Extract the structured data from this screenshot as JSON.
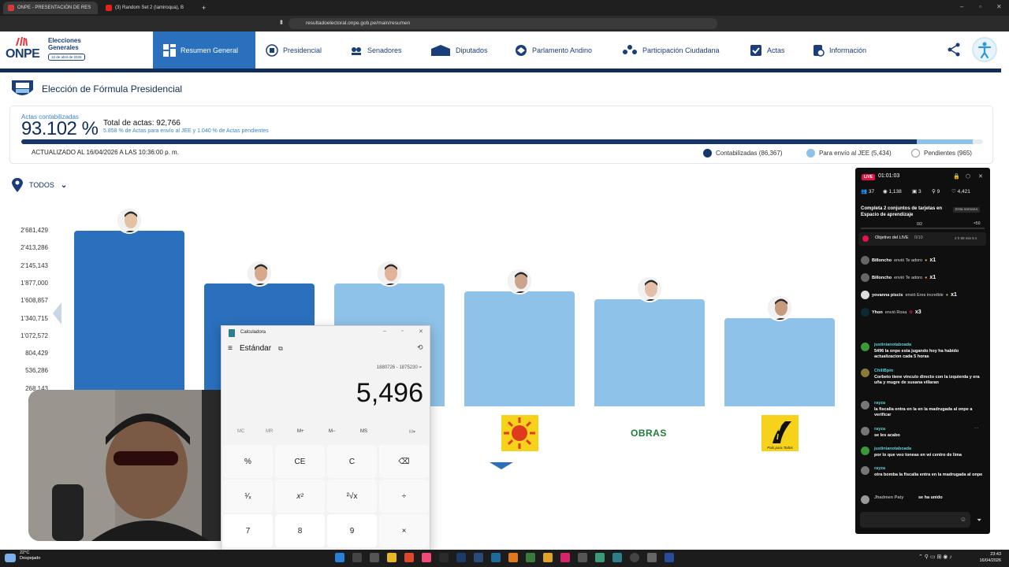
{
  "browser": {
    "tabs": [
      {
        "title": "ONPE - PRESENTACIÓN DE RES"
      },
      {
        "title": "(3) Random Set 2 (Iamiroqua), B"
      }
    ],
    "new_tab": "+",
    "url": "resultadoelectoral.onpe.gob.pe/main/resumen"
  },
  "header": {
    "logo": "ONPE",
    "elecciones": "Elecciones Generales",
    "date_badge": "12 de abril de 2026",
    "nav": [
      {
        "label": "Resumen General",
        "icon": "grid-icon"
      },
      {
        "label": "Presidencial",
        "icon": "peru-seal-icon"
      },
      {
        "label": "Senadores",
        "icon": "senate-icon"
      },
      {
        "label": "Diputados",
        "icon": "congress-icon"
      },
      {
        "label": "Parlamento Andino",
        "icon": "globe-icon"
      },
      {
        "label": "Participación Ciudadana",
        "icon": "people-icon"
      },
      {
        "label": "Actas",
        "icon": "clipboard-check-icon"
      },
      {
        "label": "Información",
        "icon": "info-doc-icon"
      }
    ]
  },
  "page": {
    "title": "Elección de Fórmula Presidencial",
    "actas_label": "Actas contabilizadas",
    "actas_pct": "93.102 %",
    "total_actas": "Total de actas: 92,766",
    "sub_text": "5.858 % de Actas para envío al JEE y 1.040 % de Actas pendientes",
    "progress": {
      "contabilizadas": 0.93102,
      "jee": 0.05858,
      "pendientes": 0.0104
    },
    "updated": "ACTUALIZADO AL 16/04/2026 A LAS 10:36:00 p. m.",
    "legend": [
      {
        "label": "Contabilizadas (86,367)",
        "color": "#153669"
      },
      {
        "label": "Para envío al JEE (5,434)",
        "color": "#8fc2e8"
      },
      {
        "label": "Pendientes (965)",
        "color": "#ffffff"
      }
    ],
    "filter": "TODOS"
  },
  "chart_data": {
    "type": "bar",
    "y_ticks": [
      "2'681,429",
      "2'413,286",
      "2'145,143",
      "1'877,000",
      "1'608,857",
      "1'340,715",
      "1'072,572",
      "804,429",
      "536,286",
      "268,143"
    ],
    "ylim": [
      0,
      2681429
    ],
    "series": [
      {
        "values": [
          2681429,
          1877000,
          1877000,
          1750000,
          1630000,
          1340715
        ]
      }
    ],
    "colors": [
      "#2a70bd",
      "#2a70bd",
      "#8fc2e8",
      "#8fc2e8",
      "#8fc2e8",
      "#8fc2e8"
    ],
    "party_labels": [
      "",
      "",
      "",
      "",
      "OBRAS",
      "País para Todos"
    ]
  },
  "calculator": {
    "title": "Calculadora",
    "mode": "Estándar",
    "expression": "1880726 - 1875230 =",
    "display": "5,496",
    "memory": [
      "MC",
      "MR",
      "M+",
      "M−",
      "MS",
      "M▾"
    ],
    "keys": [
      "%",
      "CE",
      "C",
      "⌫",
      "¹⁄ₓ",
      "x²",
      "²√x",
      "÷",
      "7",
      "8",
      "9",
      "×"
    ]
  },
  "live": {
    "badge": "LIVE",
    "time": "01:01:03",
    "stats": [
      "37",
      "1,138",
      "3",
      "9",
      "4,421"
    ],
    "task": "Completa 2 conjuntos de tarjetas en Espacio de aprendizaje",
    "week": "Esta semana",
    "task_progress": "0/2",
    "task_reward": "×50",
    "goal": "Objetivo del LIVE",
    "goal_progress": "0/10",
    "goal_time": "2 h 59 min 5 s",
    "gifts": [
      {
        "user": "Billoncho",
        "action": "envió Te adoro",
        "mult": "x1"
      },
      {
        "user": "Billoncho",
        "action": "envió Te adoro",
        "mult": "x1"
      },
      {
        "user": "yovanna piscis",
        "action": "envió Eres increíble",
        "mult": "x1"
      },
      {
        "user": "Yhon",
        "action": "envió Rosa",
        "mult": "x3"
      }
    ],
    "messages": [
      {
        "user": "justinianotaboada",
        "text": "5496 la onpe esta jugando hoy ha habido actualizacion cada 5 horas"
      },
      {
        "user": "ChiliBpin",
        "text": "Corbeto tiene vinculo directo con la izquierda y era uña y mugre de susana villaran"
      },
      {
        "user": "rayza",
        "text": "la fiscalia entra en la en la madrugada al onpe a verificar"
      },
      {
        "user": "rayza",
        "text": "se les acabo"
      },
      {
        "user": "justinianotaboada",
        "text": "por lo que veo toneas en wi centro de lima"
      },
      {
        "user": "rayza",
        "text": "otra bomba la fiscalia entra en la madrugada al onpe"
      },
      {
        "user": "Jhadmen Paty",
        "text": "se ha unido"
      }
    ]
  },
  "taskbar": {
    "temp": "22°C",
    "weather": "Despejado",
    "time": "23:43",
    "date": "16/04/2026"
  }
}
